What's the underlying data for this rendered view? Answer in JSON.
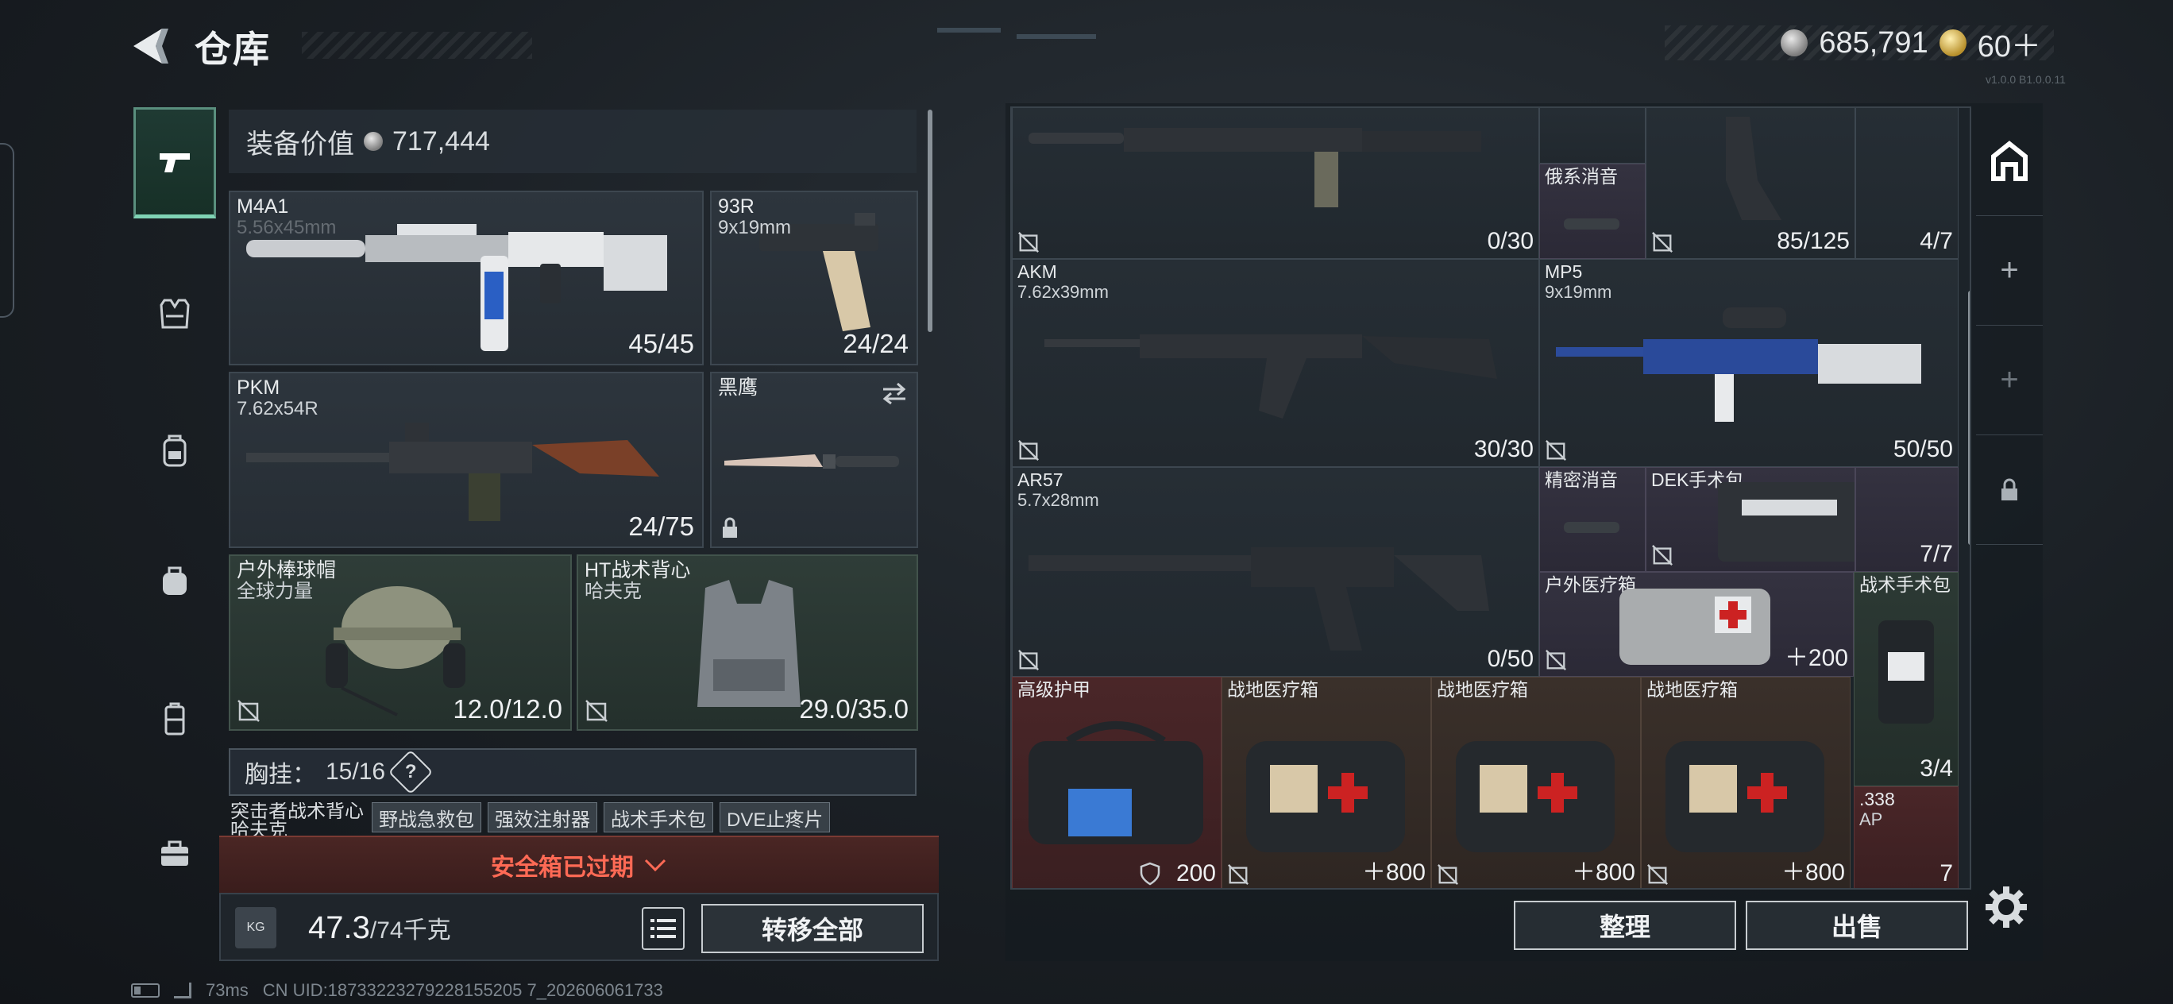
{
  "header": {
    "title": "仓库",
    "currency": [
      {
        "icon": "silver-coin-icon",
        "value": "685,791"
      },
      {
        "icon": "gold-coin-icon",
        "value": "60＋"
      }
    ],
    "version": "v1.0.0 B1.0.0.11"
  },
  "nav": {
    "items": [
      {
        "name": "weapons",
        "icon": "pistol-icon",
        "active": true
      },
      {
        "name": "armor",
        "icon": "vest-icon",
        "active": false
      },
      {
        "name": "backpack",
        "icon": "backpack-icon",
        "active": false
      },
      {
        "name": "bag",
        "icon": "bag-icon",
        "active": false
      },
      {
        "name": "case",
        "icon": "case-icon",
        "active": false
      },
      {
        "name": "toolbox",
        "icon": "toolbox-icon",
        "active": false
      }
    ]
  },
  "equipment": {
    "value_label": "装备价值",
    "value": "717,444",
    "slots": {
      "primary1": {
        "name": "M4A1",
        "sub": "5.56x45mm",
        "count": "45/45"
      },
      "sidearm": {
        "name": "93R",
        "sub": "9x19mm",
        "count": "24/24"
      },
      "primary2": {
        "name": "PKM",
        "sub": "7.62x54R",
        "count": "24/75"
      },
      "melee": {
        "name": "黑鹰",
        "sub": ""
      },
      "helmet": {
        "name": "户外棒球帽",
        "sub": "全球力量",
        "count": "12.0/12.0"
      },
      "vest": {
        "name": "HT战术背心",
        "sub": "哈夫克",
        "count": "29.0/35.0"
      }
    },
    "chest_label": "胸挂：",
    "chest_count": "15/16",
    "chest_help": "?",
    "chest_items": [
      "突击者战术背心",
      "哈夫克",
      "野战急救包",
      "强效注射器",
      "战术手术包",
      "DVE止疼片"
    ]
  },
  "safebox": {
    "label": "安全箱已过期"
  },
  "weight": {
    "value": "47.3",
    "capacity": "/74千克",
    "icon_label": "KG"
  },
  "actions": {
    "transfer_all": "转移全部",
    "tidy": "整理",
    "sell": "出售"
  },
  "status": {
    "ping": "73ms",
    "uid": "CN UID:18733223279228155205 7_202606061733"
  },
  "storage": {
    "items": [
      {
        "id": "rifle-top",
        "name": "",
        "sub": "",
        "count": "0/30"
      },
      {
        "id": "suppressor-ru",
        "name": "俄系消音",
        "sub": "",
        "count": ""
      },
      {
        "id": "stock-top",
        "name": "",
        "sub": "",
        "count": "85/125"
      },
      {
        "id": "grip-top",
        "name": "",
        "sub": "",
        "count": "4/7"
      },
      {
        "id": "akm",
        "name": "AKM",
        "sub": "7.62x39mm",
        "count": "30/30"
      },
      {
        "id": "mp5",
        "name": "MP5",
        "sub": "9x19mm",
        "count": "50/50"
      },
      {
        "id": "ar57",
        "name": "AR57",
        "sub": "5.7x28mm",
        "count": "0/50"
      },
      {
        "id": "suppressor-precision",
        "name": "精密消音",
        "sub": "",
        "count": ""
      },
      {
        "id": "dek-kit",
        "name": "DEK手术包",
        "sub": "",
        "count": "7/7"
      },
      {
        "id": "outdoor-medkit",
        "name": "户外医疗箱",
        "sub": "",
        "count": "＋200"
      },
      {
        "id": "tactical-surgery",
        "name": "战术手术包",
        "sub": "",
        "count": "3/4"
      },
      {
        "id": "advanced-armor",
        "name": "高级护甲",
        "sub": "",
        "count": "200"
      },
      {
        "id": "field-medkit-1",
        "name": "战地医疗箱",
        "sub": "",
        "count": "800"
      },
      {
        "id": "field-medkit-2",
        "name": "战地医疗箱",
        "sub": "",
        "count": "800"
      },
      {
        "id": "field-medkit-3",
        "name": "战地医疗箱",
        "sub": "",
        "count": "800"
      },
      {
        "id": "ammo-338",
        "name": ".338",
        "sub": "AP",
        "count": "7"
      }
    ]
  },
  "colors": {
    "accent_green": "#7fd3b4",
    "warning_red": "#ff6a55",
    "panel": "#262d34"
  }
}
